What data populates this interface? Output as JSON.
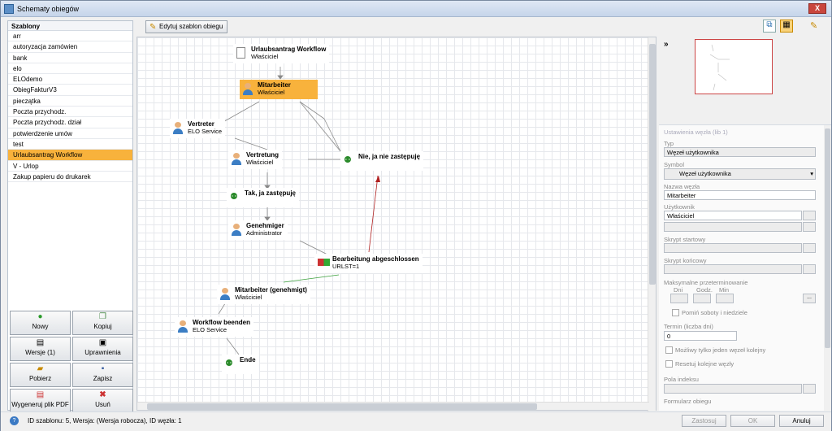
{
  "window": {
    "title": "Schematy obiegów",
    "close_label": "X"
  },
  "templates": {
    "header": "Szablony",
    "items": [
      "arr",
      "autoryzacja zamówien",
      "bank",
      "elo",
      "ELOdemo",
      "ObiegFakturV3",
      "pieczątka",
      "Poczta przychodz.",
      "Poczta przychodz. dział",
      "potwierdzenie umów",
      "test",
      "Urlaubsantrag Workflow",
      "V - Urlop",
      "Zakup papieru do drukarek"
    ],
    "selected": "Urlaubsantrag Workflow"
  },
  "buttons": {
    "new": "Nowy",
    "copy": "Kopiuj",
    "versions": "Wersje (1)",
    "permissions": "Uprawnienia",
    "fetch": "Pobierz",
    "save": "Zapisz",
    "pdf": "Wygeneruj plik PDF",
    "delete": "Usuń"
  },
  "toolbar": {
    "edit_template": "Edytuj szablon obiegu"
  },
  "nodes": {
    "start": {
      "title": "Urlaubsantrag Workflow",
      "sub": "Właściciel"
    },
    "mitarbeiter": {
      "title": "Mitarbeiter",
      "sub": "Właściciel"
    },
    "vertreter": {
      "title": "Vertreter",
      "sub": "ELO Service"
    },
    "vertretung": {
      "title": "Vertretung",
      "sub": "Właściciel"
    },
    "nie": {
      "title": "Nie, ja nie zastępuję"
    },
    "tak": {
      "title": "Tak, ja zastępuję"
    },
    "genehmiger": {
      "title": "Genehmiger",
      "sub": "Administrator"
    },
    "bearbeitung": {
      "title": "Bearbeitung abgeschlossen",
      "sub": "URLST=1"
    },
    "genehmigt": {
      "title": "Mitarbeiter (genehmigt)",
      "sub": "Właściciel"
    },
    "beenden": {
      "title": "Workflow beenden",
      "sub": "ELO Service"
    },
    "ende": {
      "title": "Ende"
    }
  },
  "minimap": {
    "collapse": "»"
  },
  "props": {
    "header": "Ustawienia węzła (lib 1)",
    "typ_label": "Typ",
    "typ_value": "Węzeł użytkownika",
    "symbol_label": "Symbol",
    "symbol_value": "Węzeł użytkownika",
    "name_label": "Nazwa węzła",
    "name_value": "Mitarbeiter",
    "user_label": "Użytkownik",
    "user_value": "Właściciel",
    "start_label": "Skrypt startowy",
    "end_label": "Skrypt końcowy",
    "overdue_label": "Maksymalne przeterminowanie",
    "dni": "Dni",
    "godz": "Godz.",
    "min": "Min",
    "skip_weekend": "Pomiń soboty i niedziele",
    "term_label": "Termin (liczba dni)",
    "term_value": "0",
    "only_one": "Możliwy tylko jeden węzeł kolejny",
    "reset": "Resetuj kolejne węzły",
    "index_label": "Pola indeksu",
    "form_label": "Formularz obiegu",
    "more": "..."
  },
  "footer": {
    "status": "ID szablonu: 5, Wersja:  (Wersja robocza), ID węzła: 1",
    "apply": "Zastosuj",
    "ok": "OK",
    "cancel": "Anuluj"
  }
}
